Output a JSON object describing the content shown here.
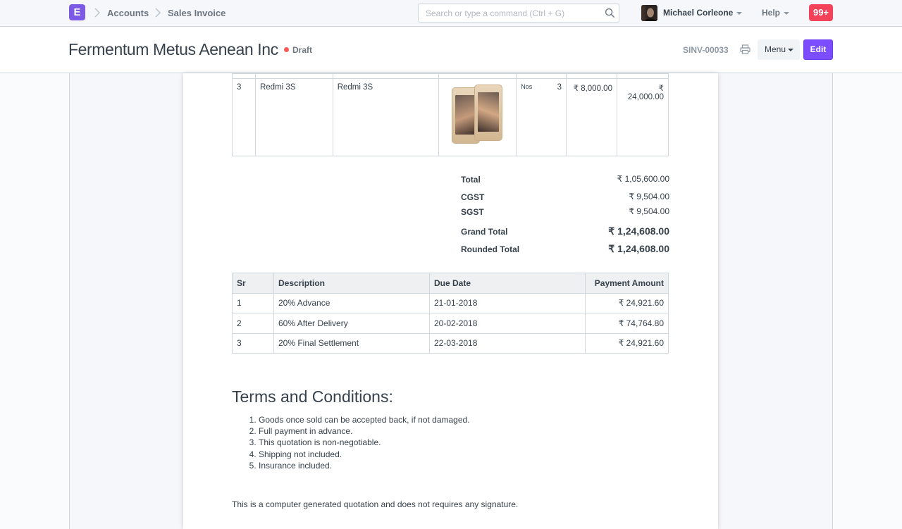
{
  "navbar": {
    "logo_letter": "E",
    "breadcrumbs": [
      "Accounts",
      "Sales Invoice"
    ],
    "search_placeholder": "Search or type a command (Ctrl + G)",
    "user_name": "Michael Corleone",
    "help_label": "Help",
    "notification_count": "99+"
  },
  "page_head": {
    "title": "Fermentum Metus Aenean Inc",
    "status": "Draft",
    "doc_name": "SINV-00033",
    "menu_label": "Menu",
    "edit_label": "Edit"
  },
  "items": [
    {
      "sr": "3",
      "item_code": "Redmi 3S",
      "item_name": "Redmi 3S",
      "uom": "Nos",
      "qty": "3",
      "rate": "₹ 8,000.00",
      "amount": "₹ 24,000.00"
    }
  ],
  "totals": [
    {
      "label": "Total",
      "value": "₹ 1,05,600.00"
    },
    {
      "label": "CGST",
      "value": "₹ 9,504.00"
    },
    {
      "label": "SGST",
      "value": "₹ 9,504.00"
    },
    {
      "label": "Grand Total",
      "value": "₹ 1,24,608.00"
    },
    {
      "label": "Rounded Total",
      "value": "₹ 1,24,608.00"
    }
  ],
  "payment_schedule": {
    "headers": [
      "Sr",
      "Description",
      "Due Date",
      "Payment Amount"
    ],
    "rows": [
      [
        "1",
        "20% Advance",
        "21-01-2018",
        "₹ 24,921.60"
      ],
      [
        "2",
        "60% After Delivery",
        "20-02-2018",
        "₹ 74,764.80"
      ],
      [
        "3",
        "20% Final Settlement",
        "22-03-2018",
        "₹ 24,921.60"
      ]
    ]
  },
  "terms": {
    "title": "Terms and Conditions:",
    "items": [
      "Goods once sold can be accepted back, if not damaged.",
      "Full payment in advance.",
      "This quotation is non-negotiable.",
      "Shipping not included.",
      "Insurance included."
    ]
  },
  "footer_note": "This is a computer generated quotation and does not requires any signature.",
  "colors": {
    "brand": "#7c5ae6",
    "primary_button": "#7c4dff",
    "notification": "#f5425b",
    "draft_indicator": "#ff5858"
  }
}
